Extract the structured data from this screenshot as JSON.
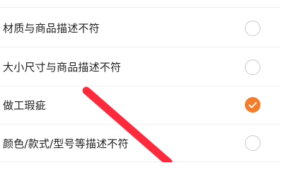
{
  "reasons": [
    {
      "label": "材质与商品描述不符",
      "selected": false
    },
    {
      "label": "大小尺寸与商品描述不符",
      "selected": false
    },
    {
      "label": "做工瑕疵",
      "selected": true
    },
    {
      "label": "颜色/款式/型号等描述不符",
      "selected": false
    }
  ],
  "colors": {
    "accent": "#f57c2b",
    "annotation": "#ff2a3c",
    "divider": "#efefef",
    "radio_border": "#c9c9c9"
  },
  "icons": {
    "selected": "checkmark-icon"
  }
}
